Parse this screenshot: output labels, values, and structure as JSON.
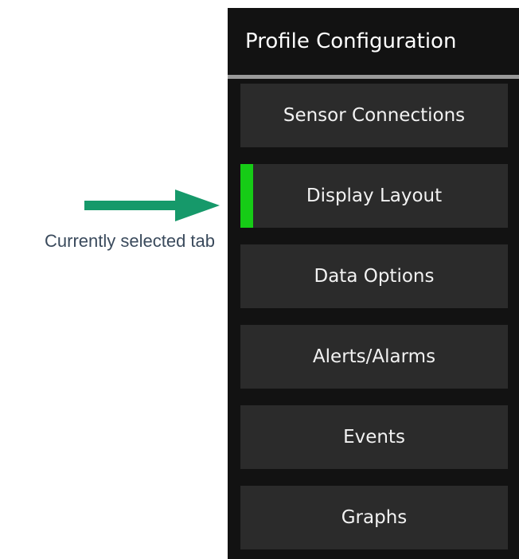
{
  "annotation": {
    "label": "Currently selected tab",
    "arrow_color": "#16996a"
  },
  "panel": {
    "title": "Profile Configuration",
    "selected_indicator_color": "#16cc16",
    "tabs": [
      {
        "label": "Sensor Connections",
        "selected": false
      },
      {
        "label": "Display Layout",
        "selected": true
      },
      {
        "label": "Data Options",
        "selected": false
      },
      {
        "label": "Alerts/Alarms",
        "selected": false
      },
      {
        "label": "Events",
        "selected": false
      },
      {
        "label": "Graphs",
        "selected": false
      }
    ]
  }
}
